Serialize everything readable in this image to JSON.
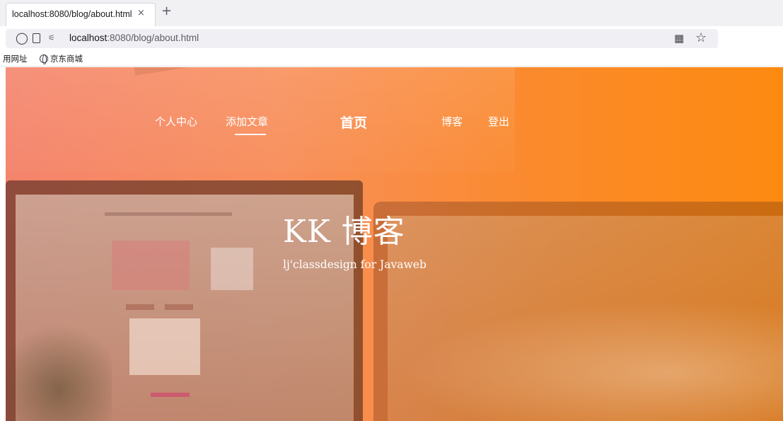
{
  "browser": {
    "tab_title": "localhost:8080/blog/about.html",
    "tab_close": "×",
    "new_tab": "+",
    "url_host": "localhost",
    "url_rest": ":8080/blog/about.html",
    "icons": {
      "shield": "shield-icon",
      "page": "page-icon",
      "permissions": "permissions-icon",
      "qr": "qr-code-icon",
      "bookmark": "star-icon"
    }
  },
  "bookmarks": [
    {
      "label": "用网址"
    },
    {
      "label": "京东商城",
      "icon": "globe-icon"
    }
  ],
  "site_nav": {
    "personal": "个人中心",
    "add_article": "添加文章",
    "home": "首页",
    "blog": "博客",
    "logout": "登出",
    "active": "添加文章"
  },
  "hero": {
    "title": "KK 博客",
    "subtitle": "lj'classdesign for Javaweb",
    "gradient_start": "#f4846c",
    "gradient_end": "#fd8a10"
  }
}
